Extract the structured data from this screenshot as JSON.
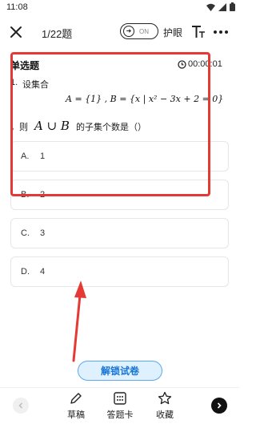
{
  "status": {
    "time": "11:08"
  },
  "header": {
    "progress": "1/22题",
    "toggle_state": "ON",
    "eye_care_label": "护眼"
  },
  "question": {
    "type": "单选题",
    "timer": "00:00:01",
    "number": "1.",
    "line1": "设集合",
    "formula": "A = {1} ,  B = {x | x² − 3x + 2 = 0}",
    "line2_prefix": "，则",
    "line2_expr": "A ∪ B",
    "line2_suffix": "的子集个数是（）"
  },
  "options": [
    {
      "letter": "A.",
      "text": "1"
    },
    {
      "letter": "B.",
      "text": "2"
    },
    {
      "letter": "C.",
      "text": "3"
    },
    {
      "letter": "D.",
      "text": "4"
    }
  ],
  "unlock_label": "解锁试卷",
  "toolbar": {
    "draft_label": "草稿",
    "answer_card_label": "答题卡",
    "favorite_label": "收藏"
  },
  "colors": {
    "highlight": "#e53935",
    "unlock_text": "#1576d8",
    "unlock_bg": "#dff0ff"
  }
}
